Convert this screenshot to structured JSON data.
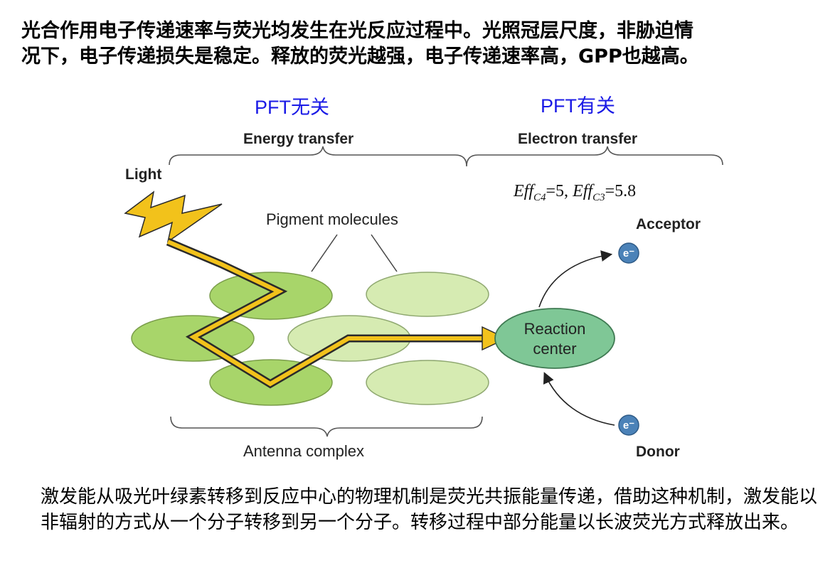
{
  "header": {
    "line1": "光合作用电子传递速率与荧光均发生在光反应过程中。光照冠层尺度，非胁迫情",
    "line2": "况下，电子传递损失是稳定。释放的荧光越强，电子传递速率高，GPP也越高。"
  },
  "diagram": {
    "pft_unrelated": "PFT无关",
    "pft_related": "PFT有关",
    "energy_transfer": "Energy transfer",
    "electron_transfer": "Electron transfer",
    "light": "Light",
    "pigment_molecules": "Pigment molecules",
    "reaction_center_line1": "Reaction",
    "reaction_center_line2": "center",
    "acceptor": "Acceptor",
    "donor": "Donor",
    "antenna_complex": "Antenna complex",
    "electron_symbol": "e⁻",
    "eff_prefix": "Eff",
    "eff_c4_sub": "C4",
    "eff_c4_value": "=5, ",
    "eff_c3_sub": "C3",
    "eff_c3_value": "=5.8",
    "colors": {
      "pigment_dark": "#a8d56a",
      "pigment_light": "#d6ebb2",
      "reaction_center": "#7fc796",
      "lightning": "#f2c21b",
      "electron": "#4b82b8",
      "pft_text": "#1a1ae6"
    }
  },
  "caption": {
    "text": "激发能从吸光叶绿素转移到反应中心的物理机制是荧光共振能量传递，借助这种机制，激发能以非辐射的方式从一个分子转移到另一个分子。转移过程中部分能量以长波荧光方式释放出来。"
  }
}
